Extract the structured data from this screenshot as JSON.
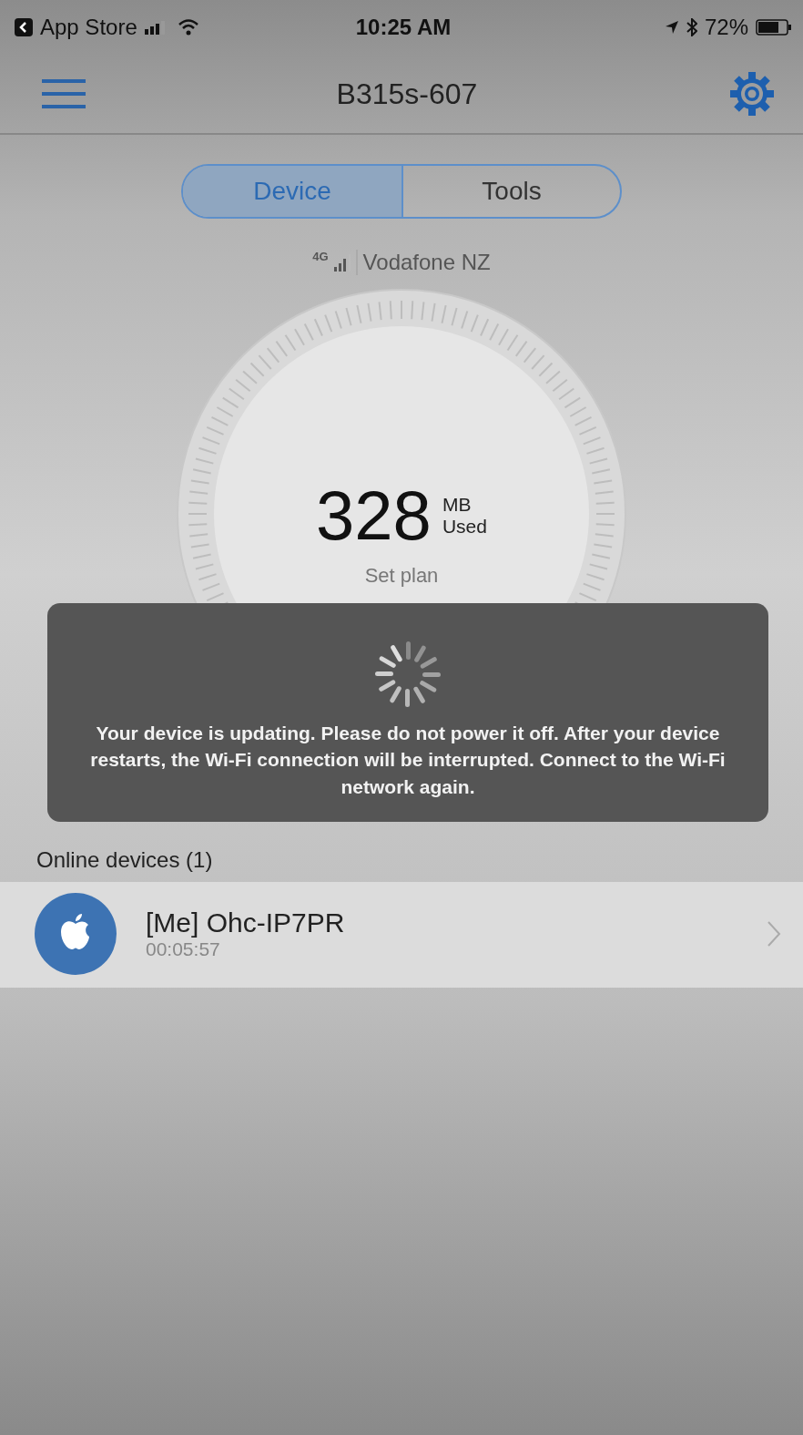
{
  "status_bar": {
    "back_label": "App Store",
    "time": "10:25 AM",
    "battery": "72%"
  },
  "header": {
    "title": "B315s-607"
  },
  "tabs": [
    {
      "label": "Device",
      "selected": true
    },
    {
      "label": "Tools",
      "selected": false
    }
  ],
  "network": {
    "type": "4G",
    "operator": "Vodafone NZ"
  },
  "usage": {
    "value": "328",
    "unit": "MB",
    "caption": "Used",
    "link": "Set plan"
  },
  "toast": {
    "message": "Your device is updating. Please do not power it off. After your device restarts, the Wi-Fi connection will be interrupted. Connect to the Wi-Fi network again."
  },
  "online_devices": {
    "title": "Online devices (1)",
    "items": [
      {
        "name": "[Me] Ohc-IP7PR",
        "duration": "00:05:57"
      }
    ]
  }
}
